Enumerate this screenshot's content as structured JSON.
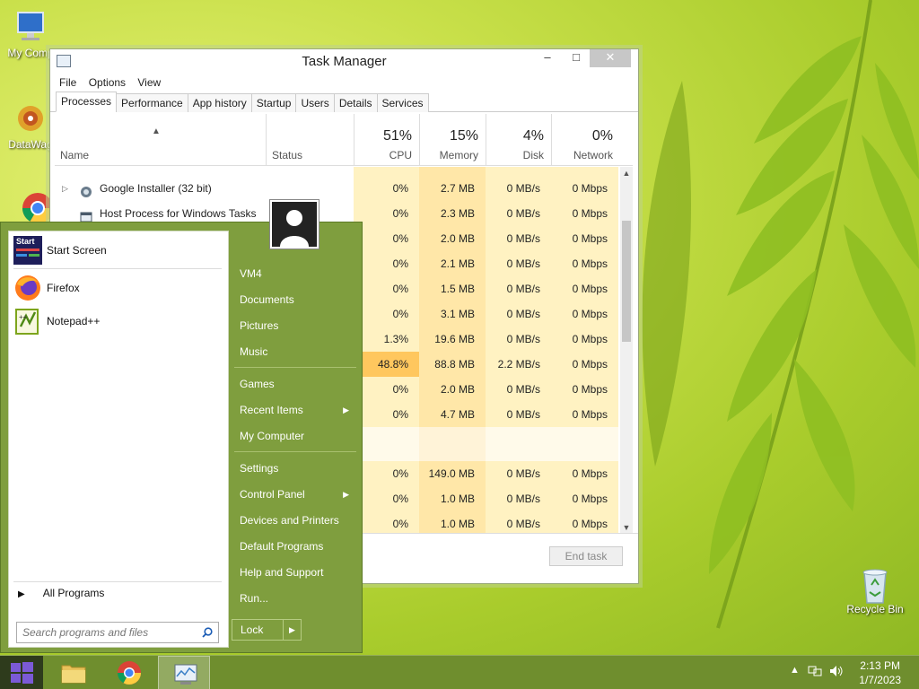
{
  "desktop": {
    "icons": [
      {
        "label": "My Comp"
      },
      {
        "label": "DataWag"
      },
      {
        "label": ""
      },
      {
        "label": "Recycle Bin"
      }
    ]
  },
  "task_manager": {
    "title": "Task Manager",
    "menu": [
      "File",
      "Options",
      "View"
    ],
    "tabs": [
      "Processes",
      "Performance",
      "App history",
      "Startup",
      "Users",
      "Details",
      "Services"
    ],
    "active_tab": "Processes",
    "columns": {
      "name": "Name",
      "status": "Status",
      "cpu": {
        "pct": "51%",
        "label": "CPU"
      },
      "memory": {
        "pct": "15%",
        "label": "Memory"
      },
      "disk": {
        "pct": "4%",
        "label": "Disk"
      },
      "network": {
        "pct": "0%",
        "label": "Network"
      }
    },
    "rows": [
      {
        "name": "Google Installer (32 bit)",
        "cpu": "0%",
        "mem": "2.7 MB",
        "disk": "0 MB/s",
        "net": "0 Mbps"
      },
      {
        "name": "Host Process for Windows Tasks",
        "cpu": "0%",
        "mem": "2.3 MB",
        "disk": "0 MB/s",
        "net": "0 Mbps"
      },
      {
        "name": "",
        "cpu": "0%",
        "mem": "2.0 MB",
        "disk": "0 MB/s",
        "net": "0 Mbps"
      },
      {
        "name": "",
        "cpu": "0%",
        "mem": "2.1 MB",
        "disk": "0 MB/s",
        "net": "0 Mbps"
      },
      {
        "name": "",
        "cpu": "0%",
        "mem": "1.5 MB",
        "disk": "0 MB/s",
        "net": "0 Mbps"
      },
      {
        "name": "",
        "cpu": "0%",
        "mem": "3.1 MB",
        "disk": "0 MB/s",
        "net": "0 Mbps"
      },
      {
        "name": "",
        "cpu": "1.3%",
        "mem": "19.6 MB",
        "disk": "0 MB/s",
        "net": "0 Mbps"
      },
      {
        "name": "",
        "cpu": "48.8%",
        "mem": "88.8 MB",
        "disk": "2.2 MB/s",
        "net": "0 Mbps"
      },
      {
        "name": "",
        "cpu": "0%",
        "mem": "2.0 MB",
        "disk": "0 MB/s",
        "net": "0 Mbps"
      },
      {
        "name": "",
        "cpu": "0%",
        "mem": "4.7 MB",
        "disk": "0 MB/s",
        "net": "0 Mbps"
      },
      {
        "name": "",
        "cpu": "",
        "mem": "",
        "disk": "",
        "net": ""
      },
      {
        "name": "",
        "cpu": "0%",
        "mem": "149.0 MB",
        "disk": "0 MB/s",
        "net": "0 Mbps"
      },
      {
        "name": "",
        "cpu": "0%",
        "mem": "1.0 MB",
        "disk": "0 MB/s",
        "net": "0 Mbps"
      },
      {
        "name": "",
        "cpu": "0%",
        "mem": "1.0 MB",
        "disk": "0 MB/s",
        "net": "0 Mbps"
      }
    ],
    "end_task": "End task"
  },
  "start_menu": {
    "pinned": [
      {
        "label": "Start Screen",
        "icon_text": "Start"
      },
      {
        "label": "Firefox"
      },
      {
        "label": "Notepad++"
      }
    ],
    "all_programs": "All Programs",
    "search_placeholder": "Search programs and files",
    "right_items": [
      {
        "label": "VM4"
      },
      {
        "label": "Documents"
      },
      {
        "label": "Pictures"
      },
      {
        "label": "Music"
      },
      {
        "label": "Games"
      },
      {
        "label": "Recent Items"
      },
      {
        "label": "My Computer"
      },
      {
        "label": "Settings"
      },
      {
        "label": "Control Panel"
      },
      {
        "label": "Devices and Printers"
      },
      {
        "label": "Default Programs"
      },
      {
        "label": "Help and Support"
      },
      {
        "label": "Run..."
      }
    ],
    "lock": "Lock"
  },
  "taskbar": {
    "time": "2:13 PM",
    "date": "1/7/2023"
  },
  "colors": {
    "cpu_highlight": "#ffc75e",
    "start_menu_bg": "#7f9e3e",
    "taskbar_bg": "#6f8e2e"
  }
}
